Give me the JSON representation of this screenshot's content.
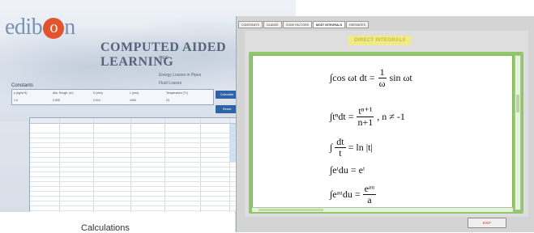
{
  "background_window": {
    "logo_prefix": "edib",
    "logo_o": "o",
    "logo_suffix": "n",
    "title": "COMPUTED AIDED LEARNING",
    "subtitle_1": "ITEC",
    "subtitle_2": "Energy Losses in Pipes",
    "subtitle_3": "Fluid Losses",
    "constants_label": "Constants",
    "constants_headers": [
      "p (kg/m^3)",
      "Abs. Rough. (m)",
      "D (mm)",
      "L (mm)",
      "Temperature (°C)"
    ],
    "constants_values": [
      "1.0",
      "0.005",
      "0.014",
      "1000",
      "20"
    ],
    "button_a": "Calculate",
    "button_b": "Reset",
    "grid_headers": [
      "Water Vel. (l/s)",
      "Flow (l)",
      "P1 (Pa)",
      "P2 (Pa)",
      "Pressure loss (Pa)",
      "Fric. loss"
    ],
    "caption": "Calculations"
  },
  "foreground_window": {
    "tabs": [
      {
        "label": "CONSTANTS"
      },
      {
        "label": "GLANCE"
      },
      {
        "label": "CONV FACTORS"
      },
      {
        "label": "MOST INTEGRALS"
      },
      {
        "label": "DERIVATES"
      }
    ],
    "active_tab_index": 3,
    "panel_title": "DIRECT INTEGRALS",
    "exit_label": "EXIT"
  },
  "formulas": [
    {
      "lhs": "∫cos ωt dt =",
      "num": "1",
      "den": "ω",
      "rhs": "sin ωt"
    },
    {
      "lhs": "∫tⁿdt =",
      "num": "tⁿ⁺¹",
      "den": "n+1",
      "rhs": ", n ≠ -1"
    },
    {
      "lhs": "∫",
      "num": "dt",
      "den": "t",
      "rhs": "= ln |t|"
    },
    {
      "lhs": "∫eᵗdu = eᵗ"
    },
    {
      "lhs": "∫eᵃᵘdu =",
      "num": "eᵃᵘ",
      "den": "a"
    }
  ],
  "colors": {
    "accent_green": "#93c66a",
    "title_yellow": "#f1ea8a",
    "logo_orange": "#e2542e",
    "button_blue": "#2f63a6"
  }
}
